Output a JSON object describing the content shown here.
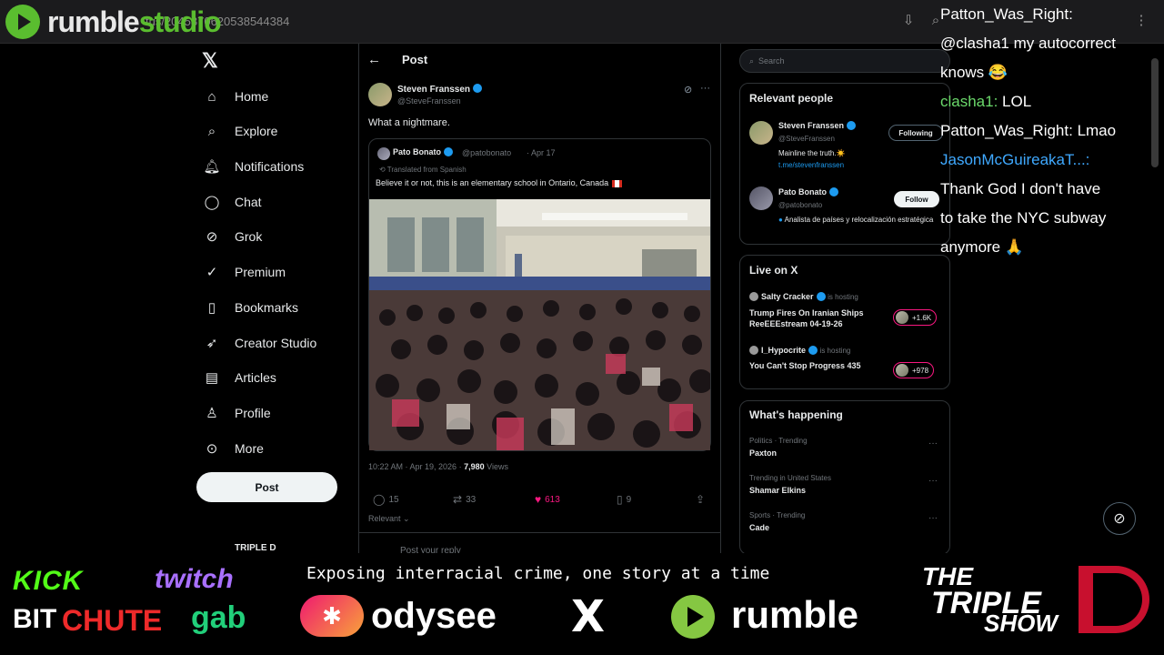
{
  "browser": {
    "overlay_logo_a": "rumble",
    "overlay_logo_b": "studio",
    "url_visible": "tus/2045870620538544384"
  },
  "nav": {
    "items": [
      {
        "label": "Home",
        "icon": "home-icon"
      },
      {
        "label": "Explore",
        "icon": "search-icon"
      },
      {
        "label": "Notifications",
        "icon": "bell-icon"
      },
      {
        "label": "Chat",
        "icon": "chat-icon"
      },
      {
        "label": "Grok",
        "icon": "grok-icon"
      },
      {
        "label": "Premium",
        "icon": "x-premium-icon"
      },
      {
        "label": "Bookmarks",
        "icon": "bookmark-icon"
      },
      {
        "label": "Creator Studio",
        "icon": "rocket-icon"
      },
      {
        "label": "Articles",
        "icon": "article-icon"
      },
      {
        "label": "Profile",
        "icon": "person-icon"
      },
      {
        "label": "More",
        "icon": "more-circle-icon"
      }
    ],
    "post_button": "Post",
    "account_name": "TRIPLE D"
  },
  "post": {
    "header_title": "Post",
    "author_name": "Steven Franssen",
    "author_handle": "@SteveFranssen",
    "text": "What a nightmare.",
    "quote": {
      "name": "Pato Bonato",
      "handle": "@patobonato",
      "date": "· Apr 17",
      "translated": "Translated from Spanish",
      "text": "Believe it or not, this is an elementary school in Ontario, Canada"
    },
    "timestamp": "10:22 AM · Apr 19, 2026 · ",
    "views_count": "7,980",
    "views_label": " Views",
    "actions": {
      "replies": "15",
      "reposts": "33",
      "likes": "613",
      "bookmarks": "9"
    },
    "sort_label": "Relevant ⌄",
    "reply_placeholder": "Post your reply"
  },
  "sidebar": {
    "search_placeholder": "Search",
    "relevant_title": "Relevant people",
    "people": [
      {
        "name": "Steven Franssen",
        "handle": "@SteveFranssen",
        "bio": "Mainline the truth.☀️",
        "link": "t.me/stevenfranssen",
        "button": "Following"
      },
      {
        "name": "Pato Bonato",
        "handle": "@patobonato",
        "bio": "Analista de países y relocalización estratégica",
        "button": "Follow"
      }
    ],
    "live_title": "Live on X",
    "live": [
      {
        "host": "Salty Cracker",
        "status": "is hosting",
        "title": "Trump Fires On Iranian Ships ReeEEEstream 04-19-26",
        "count": "+1.6K"
      },
      {
        "host": "I_Hypocrite",
        "status": "is hosting",
        "title": "You Can't Stop Progress 435",
        "count": "+978"
      }
    ],
    "happening_title": "What's happening",
    "trends": [
      {
        "context": "Politics · Trending",
        "name": "Paxton"
      },
      {
        "context": "Trending in United States",
        "name": "Shamar Elkins"
      },
      {
        "context": "Sports · Trending",
        "name": "Cade"
      }
    ]
  },
  "chat": {
    "lines": [
      {
        "name": "Patton_Was_Right:",
        "name_color": "white",
        "msg": ""
      },
      {
        "name": "",
        "name_color": "white",
        "msg": "@clasha1 my autocorrect"
      },
      {
        "name": "",
        "name_color": "white",
        "msg": "knows 😂"
      },
      {
        "name": "clasha1:",
        "name_color": "green",
        "msg": " LOL"
      },
      {
        "name": "Patton_Was_Right:",
        "name_color": "white",
        "msg": " Lmao"
      },
      {
        "name": "JasonMcGuireakaT...:",
        "name_color": "blue",
        "msg": ""
      },
      {
        "name": "",
        "name_color": "white",
        "msg": "Thank God I don't have"
      },
      {
        "name": "",
        "name_color": "white",
        "msg": "to take the NYC subway"
      },
      {
        "name": "",
        "name_color": "white",
        "msg": "anymore 🙏"
      }
    ]
  },
  "banner": {
    "tagline": "Exposing interracial crime, one story at a time",
    "kick": "KICK",
    "twitch": "twitch",
    "bit": "BIT",
    "chute": "CHUTE",
    "gab": "gab",
    "odysee": "odysee",
    "x": "X",
    "rumble": "rumble",
    "show_line1": "THE",
    "show_line2": "TRIPLE",
    "show_line3": "SHOW"
  },
  "colors": {
    "x_blue": "#1d9bf0",
    "like_pink": "#f91880",
    "rumble_green": "#5abd2f",
    "chat_green": "#6bd96b",
    "chat_blue": "#3fa9ff"
  }
}
